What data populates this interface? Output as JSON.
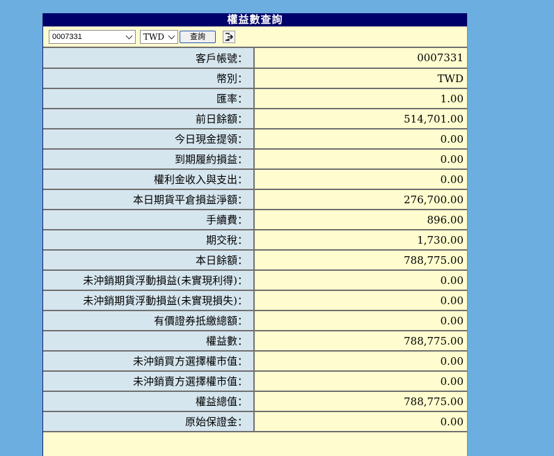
{
  "panel": {
    "title": "權益數查詢"
  },
  "toolbar": {
    "account_selected": "0007331",
    "currency_selected": "TWD",
    "query_label": "查詢",
    "logout_icon": "logout-icon"
  },
  "rows": [
    {
      "label": "客戶帳號：",
      "value": "0007331"
    },
    {
      "label": "幣別：",
      "value": "TWD"
    },
    {
      "label": "匯率：",
      "value": "1.00"
    },
    {
      "label": "前日餘額：",
      "value": "514,701.00"
    },
    {
      "label": "今日現金提領：",
      "value": "0.00"
    },
    {
      "label": "到期履約損益：",
      "value": "0.00"
    },
    {
      "label": "權利金收入與支出：",
      "value": "0.00"
    },
    {
      "label": "本日期貨平倉損益淨額：",
      "value": "276,700.00"
    },
    {
      "label": "手續費：",
      "value": "896.00"
    },
    {
      "label": "期交稅：",
      "value": "1,730.00"
    },
    {
      "label": "本日餘額：",
      "value": "788,775.00"
    },
    {
      "label": "未沖銷期貨浮動損益(未實現利得)：",
      "value": "0.00"
    },
    {
      "label": "未沖銷期貨浮動損益(未實現損失)：",
      "value": "0.00"
    },
    {
      "label": "有價證券抵繳總額：",
      "value": "0.00"
    },
    {
      "label": "權益數：",
      "value": "788,775.00"
    },
    {
      "label": "未沖銷買方選擇權市值：",
      "value": "0.00"
    },
    {
      "label": "未沖銷賣方選擇權市值：",
      "value": "0.00"
    },
    {
      "label": "權益總值：",
      "value": "788,775.00"
    },
    {
      "label": "原始保證金：",
      "value": "0.00"
    }
  ],
  "colors": {
    "background": "#6daee0",
    "title_bar": "#00006a",
    "label_cell": "#d6e6ef",
    "value_cell": "#fffdcf"
  }
}
